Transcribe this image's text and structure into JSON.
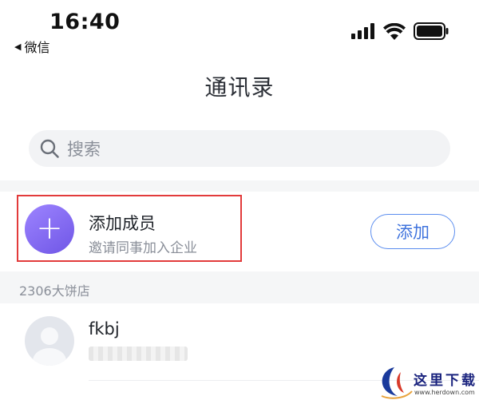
{
  "status_bar": {
    "time": "16:40",
    "back_app": "微信",
    "icons": [
      "cellular-signal-icon",
      "wifi-icon",
      "battery-icon"
    ]
  },
  "nav": {
    "title": "通讯录"
  },
  "search": {
    "placeholder": "搜索"
  },
  "add_member": {
    "title": "添加成员",
    "subtitle": "邀请同事加入企业",
    "button": "添加",
    "icon": "plus-icon"
  },
  "section": {
    "header": "2306大饼店"
  },
  "contacts": [
    {
      "name": "fkbj"
    }
  ],
  "watermark": {
    "text": "这里下载",
    "url": "www.herdown.com"
  },
  "colors": {
    "accent": "#3f73dd",
    "avatar_gradient": [
      "#9d84ff",
      "#6f56e6"
    ],
    "highlight": "#e23b3b",
    "band": "#f5f6f7"
  }
}
